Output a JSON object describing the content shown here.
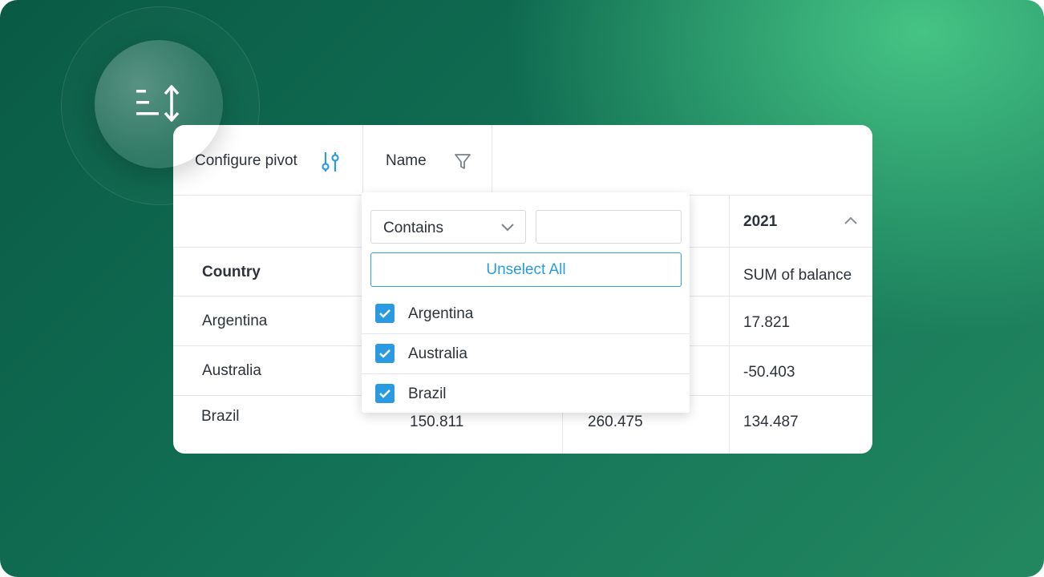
{
  "toolbar": {
    "configure_label": "Configure pivot",
    "name_label": "Name"
  },
  "grid": {
    "year_header": "2021",
    "country_header": "Country",
    "measure_header": "SUM of balance",
    "rows": [
      {
        "country": "Argentina",
        "col3": "17.821"
      },
      {
        "country": "Australia",
        "col3": "-50.403"
      },
      {
        "country": "Brazil",
        "col1": "150.811",
        "col2": "260.475",
        "col3": "134.487"
      }
    ]
  },
  "filter_popup": {
    "operator": "Contains",
    "search_value": "",
    "unselect_all_label": "Unselect All",
    "options": [
      {
        "label": "Argentina",
        "checked": true
      },
      {
        "label": "Australia",
        "checked": true
      },
      {
        "label": "Brazil",
        "checked": true
      }
    ]
  },
  "colors": {
    "accent": "#2a9be0",
    "bg_dark": "#0a5a45",
    "bg_light": "#48c887"
  }
}
